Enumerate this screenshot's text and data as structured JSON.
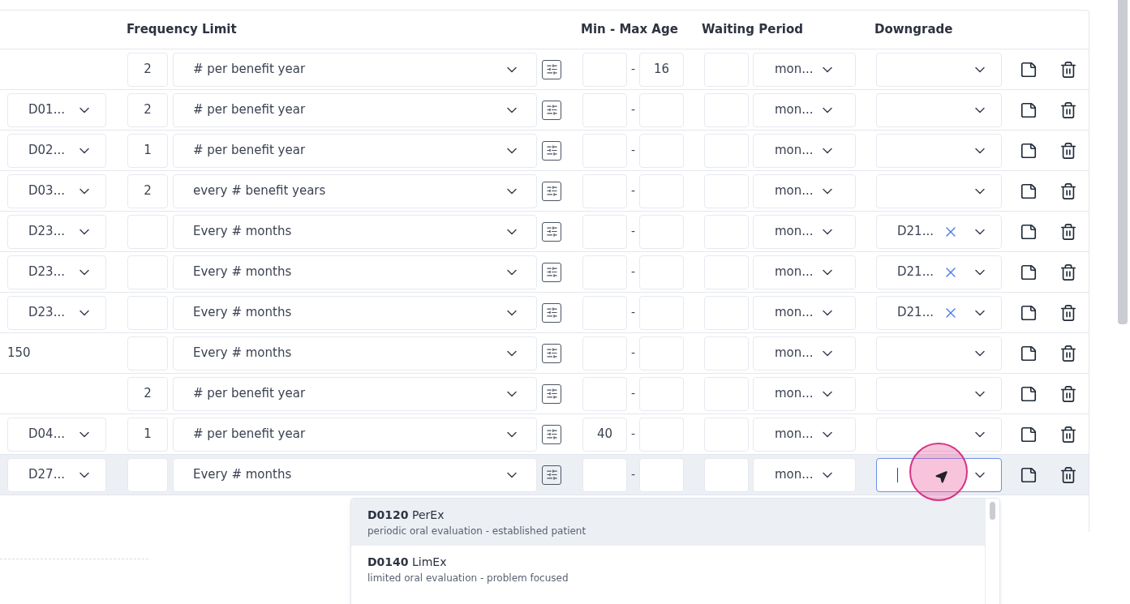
{
  "columns": [
    {
      "label": "Frequency Limit"
    },
    {
      "label": "Min - Max Age"
    },
    {
      "label": "Waiting Period"
    },
    {
      "label": "Downgrade"
    }
  ],
  "rows": [
    {
      "count": "2",
      "frequency": "# per benefit year",
      "separator": "-",
      "max_age": "16",
      "unit": "mon...",
      "highlighted": false
    },
    {
      "kind": "select",
      "code": "D01...",
      "count": "2",
      "frequency": "# per benefit year",
      "separator": "-",
      "unit": "mon...",
      "highlighted": false
    },
    {
      "kind": "select",
      "code": "D02...",
      "count": "1",
      "frequency": "# per benefit year",
      "separator": "-",
      "unit": "mon...",
      "highlighted": false
    },
    {
      "kind": "select",
      "code": "D03...",
      "count": "2",
      "frequency": "every # benefit years",
      "separator": "-",
      "unit": "mon...",
      "highlighted": false
    },
    {
      "kind": "select",
      "code": "D23...",
      "frequency": "Every # months",
      "separator": "-",
      "unit": "mon...",
      "downgrade": "D21...",
      "highlighted": false
    },
    {
      "kind": "select",
      "code": "D23...",
      "frequency": "Every # months",
      "separator": "-",
      "unit": "mon...",
      "downgrade": "D21...",
      "highlighted": false
    },
    {
      "kind": "select",
      "code": "D23...",
      "frequency": "Every # months",
      "separator": "-",
      "unit": "mon...",
      "downgrade": "D21...",
      "highlighted": false
    },
    {
      "kind": "text",
      "code": "150",
      "frequency": "Every # months",
      "separator": "-",
      "unit": "mon...",
      "highlighted": false
    },
    {
      "count": "2",
      "frequency": "# per benefit year",
      "separator": "-",
      "unit": "mon...",
      "highlighted": false
    },
    {
      "kind": "select",
      "code": "D04...",
      "count": "1",
      "frequency": "# per benefit year",
      "separator": "-",
      "min_age": "40",
      "unit": "mon...",
      "highlighted": false
    },
    {
      "kind": "select",
      "code": "D27...",
      "frequency": "Every # months",
      "separator": "-",
      "unit": "mon...",
      "highlighted": true,
      "downgrade_focused": true
    }
  ],
  "dropdown": {
    "options": [
      {
        "code": "D0120",
        "abbr": "PerEx",
        "description": "periodic oral evaluation - established patient",
        "highlighted": true
      },
      {
        "code": "D0140",
        "abbr": "LimEx",
        "description": "limited oral evaluation - problem focused",
        "highlighted": false
      }
    ]
  }
}
